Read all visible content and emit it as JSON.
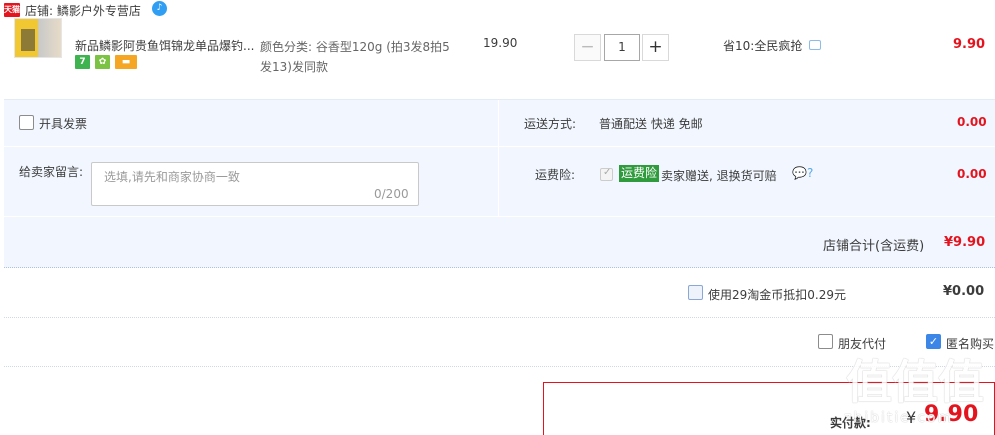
{
  "shop": {
    "badge": "天猫",
    "label": "店铺: 鳞影户外专营店",
    "wangwang": "♪"
  },
  "item": {
    "title": "新品鳞影阿贵鱼饵锦龙单品爆钓...",
    "icons": [
      "7",
      "✿",
      "▬"
    ],
    "sku": "颜色分类: 谷香型120g (拍3发8拍5发13)发同款",
    "unit_price": "19.90",
    "qty": "1",
    "qty_minus": "−",
    "qty_plus": "+",
    "promo": "省10:全民疯抢",
    "total": "9.90"
  },
  "options": {
    "invoice_label": "开具发票",
    "shipping_label": "运送方式:",
    "shipping_value": "普通配送 快递 免邮",
    "shipping_fee": "0.00",
    "message_label": "给卖家留言:",
    "message_placeholder": "选填,请先和商家协商一致",
    "message_count": "0/200",
    "insurance_label": "运费险:",
    "insurance_badge": "运费险",
    "insurance_desc": "卖家赠送, 退换货可赔",
    "insurance_icons": "💬?",
    "insurance_fee": "0.00",
    "store_total_label": "店铺合计(含运费)",
    "store_total": "¥9.90"
  },
  "coins": {
    "label": "使用29淘金币抵扣0.29元",
    "value": "¥0.00"
  },
  "pay_options": {
    "friend_label": "朋友代付",
    "anonymous_label": "匿名购买",
    "anonymous_check": "✓"
  },
  "payable": {
    "label": "实付款:",
    "yen": "¥",
    "value": "9.90"
  },
  "watermark": {
    "text": "值值值",
    "sub": "zhibitie.com"
  },
  "colors": {
    "accent_red": "#e4141e",
    "panel_bg": "#f2f7ff",
    "insurance_green": "#2f9b3c",
    "check_blue": "#3b86e6"
  }
}
